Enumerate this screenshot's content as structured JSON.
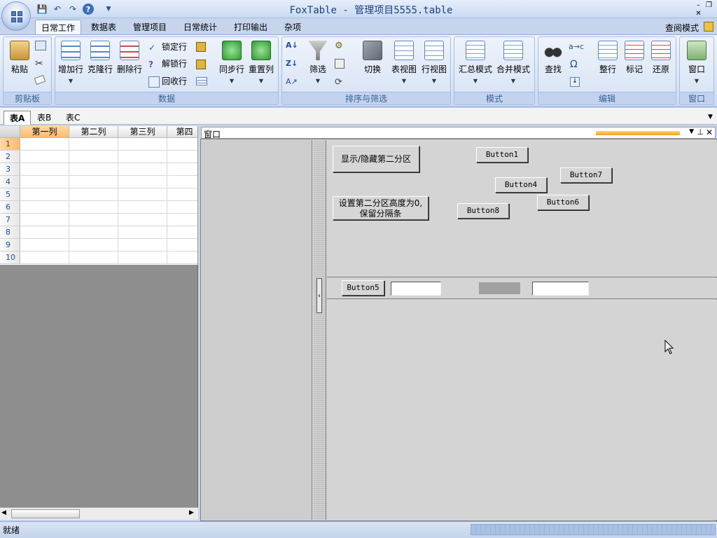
{
  "window": {
    "title": "FoxTable - 管理项目5555.table"
  },
  "ribbon": {
    "tabs": [
      {
        "label": "日常工作",
        "active": true
      },
      {
        "label": "数据表"
      },
      {
        "label": "管理项目"
      },
      {
        "label": "日常统计"
      },
      {
        "label": "打印输出"
      },
      {
        "label": "杂项"
      }
    ],
    "mode_label": "查阅模式",
    "groups": {
      "clipboard": {
        "label": "剪贴板",
        "paste": "粘贴"
      },
      "data": {
        "label": "数据",
        "add_row": "增加行",
        "clone_row": "克隆行",
        "delete_row": "删除行",
        "lock_row": "锁定行",
        "unlock_row": "解锁行",
        "recycle_row": "回收行",
        "sync_row": "同步行",
        "reset_col": "重置列"
      },
      "sort_filter": {
        "label": "排序与筛选",
        "filter": "筛选",
        "switch": "切换",
        "table_view": "表视图",
        "row_view": "行视图"
      },
      "mode": {
        "label": "模式",
        "summary_mode": "汇总模式",
        "merge_mode": "合并模式"
      },
      "edit": {
        "label": "编辑",
        "find": "查找",
        "tidy_row": "整行",
        "mark": "标记",
        "restore": "还原"
      },
      "window": {
        "label": "窗口",
        "window_btn": "窗口"
      }
    }
  },
  "sheet_tabs": [
    {
      "label": "表A",
      "active": true
    },
    {
      "label": "表B"
    },
    {
      "label": "表C"
    }
  ],
  "grid": {
    "columns": [
      "第一列",
      "第二列",
      "第三列",
      "第四"
    ],
    "rows": [
      "1",
      "2",
      "3",
      "4",
      "5",
      "6",
      "7",
      "8",
      "9",
      "10"
    ]
  },
  "panel": {
    "title": "窗口",
    "buttons": {
      "toggle_second": "显示/隐藏第二分区",
      "set_height": "设置第二分区高度为0,\n保留分隔条",
      "b1": "Button1",
      "b4": "Button4",
      "b7": "Button7",
      "b6": "Button6",
      "b8": "Button8",
      "b5": "Button5"
    },
    "input1_value": "",
    "input2_value": ""
  },
  "status": {
    "text": "就绪"
  }
}
